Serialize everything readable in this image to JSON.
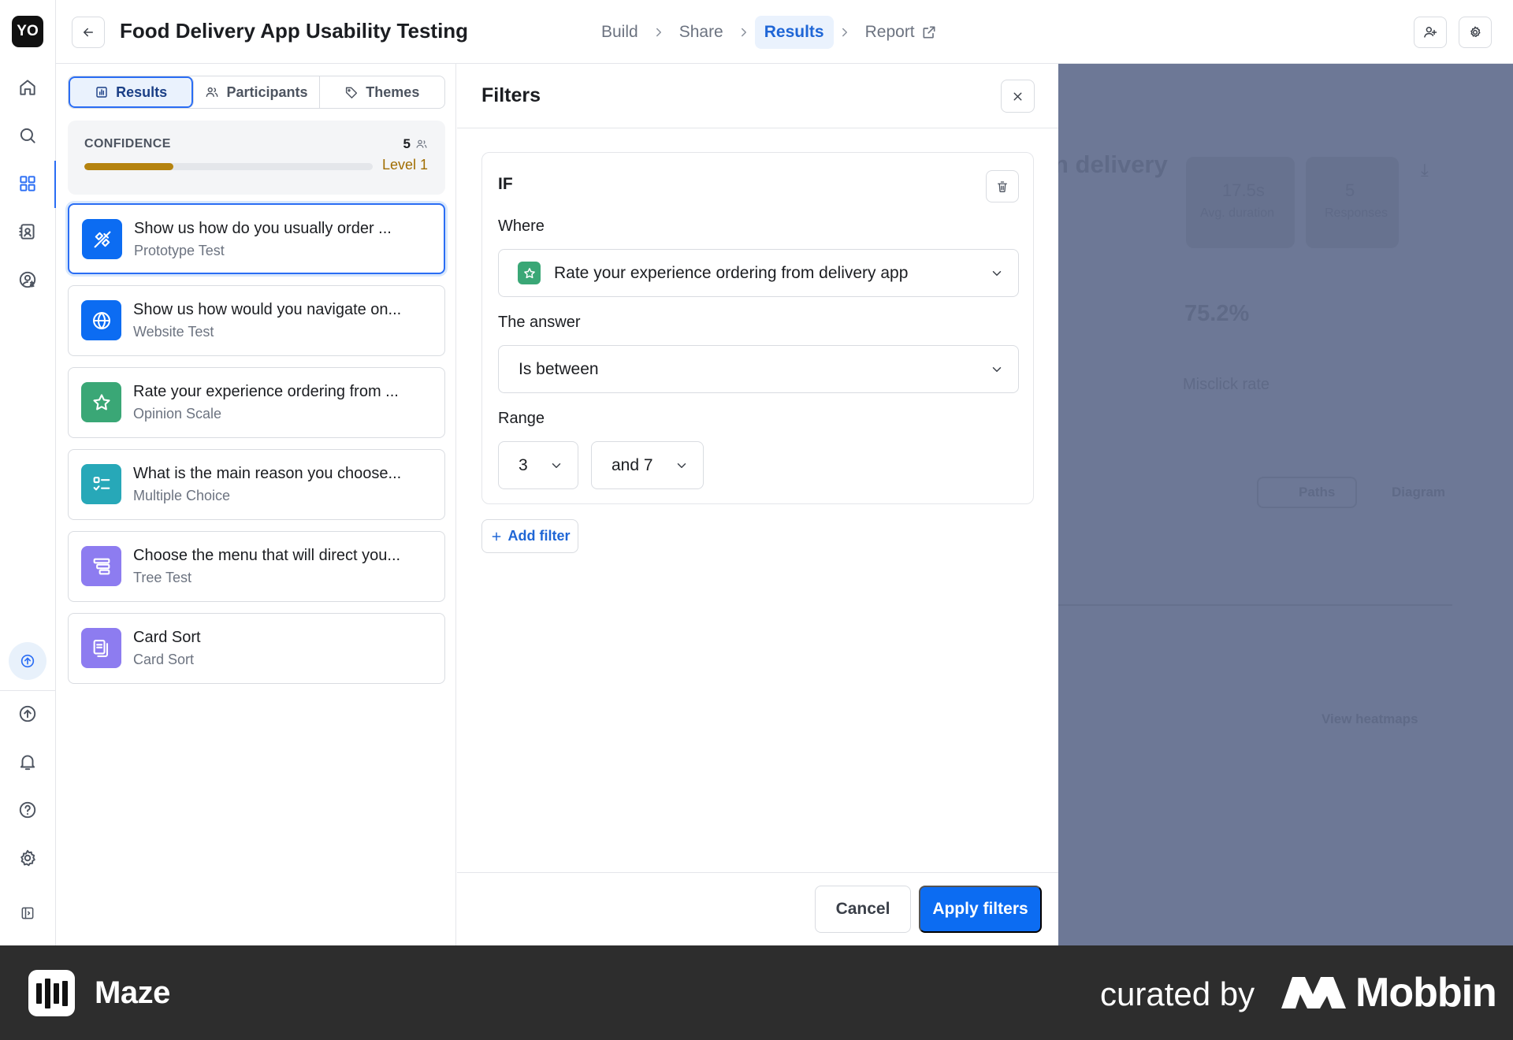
{
  "rail": {
    "logo": "YO",
    "items": [
      "home-icon",
      "search-icon",
      "grid-icon",
      "contacts-icon",
      "user-billing-icon"
    ],
    "bottom": [
      "upgrade-icon",
      "notifications-icon",
      "help-icon",
      "settings-icon",
      "collapse-icon"
    ]
  },
  "header": {
    "title": "Food Delivery App Usability Testing",
    "steps": {
      "build": "Build",
      "share": "Share",
      "results": "Results",
      "report": "Report"
    },
    "active_step": "Results"
  },
  "left_panel": {
    "tabs": {
      "results": "Results",
      "participants": "Participants",
      "themes": "Themes"
    },
    "active_tab": "Results",
    "confidence": {
      "label": "CONFIDENCE",
      "count": "5",
      "level": "Level 1",
      "progress": 0.31,
      "color": "#b5830f"
    },
    "blocks": [
      {
        "title": "Show us how do you usually order ...",
        "type": "Prototype Test",
        "icon": "prototype-icon",
        "color": "#0c6cf2"
      },
      {
        "title": "Show us how would you navigate on...",
        "type": "Website Test",
        "icon": "globe-icon",
        "color": "#0c6cf2"
      },
      {
        "title": "Rate your experience ordering from ...",
        "type": "Opinion Scale",
        "icon": "star-icon",
        "color": "#3aa776"
      },
      {
        "title": "What is the main reason you choose...",
        "type": "Multiple Choice",
        "icon": "checklist-icon",
        "color": "#27a8b8"
      },
      {
        "title": "Choose the menu that will direct you...",
        "type": "Tree Test",
        "icon": "tree-icon",
        "color": "#8d7cf0"
      },
      {
        "title": "Card Sort",
        "type": "Card Sort",
        "icon": "cards-icon",
        "color": "#8d7cf0"
      }
    ]
  },
  "filters": {
    "title": "Filters",
    "if_label": "IF",
    "where_label": "Where",
    "where_value": "Rate your experience ordering from delivery app",
    "answer_label": "The answer",
    "answer_value": "Is between",
    "range_label": "Range",
    "range_from": "3",
    "range_to": "and 7",
    "add_filter": "Add filter",
    "cancel": "Cancel",
    "apply": "Apply filters",
    "apply_color": "#0c6cf2"
  },
  "background": {
    "heading_fragment": "n delivery",
    "stats": [
      {
        "value": "17.5s",
        "label": "Avg. duration"
      },
      {
        "value": "5",
        "label": "Responses"
      }
    ],
    "misclick_value": "75.2%",
    "misclick_label": "Misclick rate",
    "paths": "Paths",
    "diagram": "Diagram",
    "view_heatmaps": "View heatmaps"
  },
  "footer": {
    "brand": "Maze",
    "curated": "curated by",
    "mobbin": "Mobbin"
  }
}
